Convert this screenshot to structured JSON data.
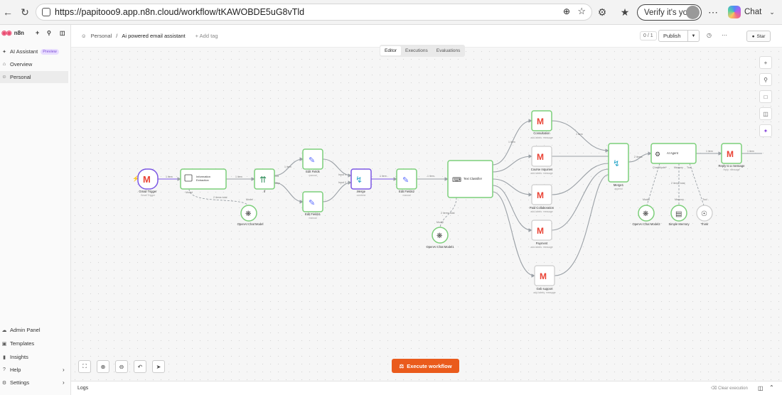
{
  "browser": {
    "url": "https://papitooo9.app.n8n.cloud/workflow/tKAWOBDE5uG8vTld",
    "verify_label": "Verify it's you",
    "chat_label": "Chat"
  },
  "sidebar": {
    "brand": "n8n",
    "items_top": [
      {
        "label": "AI Assistant",
        "badge": "Preview",
        "icon": "sparkle-icon"
      },
      {
        "label": "Overview",
        "icon": "home-icon"
      },
      {
        "label": "Personal",
        "icon": "user-icon"
      }
    ],
    "items_bottom": [
      {
        "label": "Admin Panel",
        "icon": "cloud-icon"
      },
      {
        "label": "Templates",
        "icon": "box-icon"
      },
      {
        "label": "Insights",
        "icon": "chart-icon"
      },
      {
        "label": "Help",
        "icon": "help-icon"
      },
      {
        "label": "Settings",
        "icon": "gear-icon"
      }
    ]
  },
  "header": {
    "project": "Personal",
    "workflow_title": "Ai powered email assistant",
    "add_tag": "+ Add tag",
    "version_count": "0 / 1",
    "publish_label": "Publish",
    "star_label": "Star"
  },
  "mode_tabs": [
    "Editor",
    "Executions",
    "Evaluations"
  ],
  "execute_label": "Execute workflow",
  "logs_label": "Logs",
  "clear_execution": "Clear execution",
  "workflow": {
    "nodes": [
      {
        "id": "gmail",
        "name": "Gmail Trigger",
        "sub": "Gmail Trigger",
        "icon": "gmail-icon"
      },
      {
        "id": "ie",
        "name": "Information Extraction",
        "icon": "extract-icon"
      },
      {
        "id": "if",
        "name": "If",
        "icon": "branch-icon"
      },
      {
        "id": "edit1",
        "name": "Edit Fields",
        "sub": "manual",
        "icon": "pencil-icon"
      },
      {
        "id": "edit2",
        "name": "Edit Fields1",
        "sub": "manual",
        "icon": "pencil-icon"
      },
      {
        "id": "merge",
        "name": "Merge",
        "sub": "combine",
        "icon": "merge-icon"
      },
      {
        "id": "edit3",
        "name": "Edit Fields2",
        "sub": "manual",
        "icon": "pencil-icon"
      },
      {
        "id": "tc",
        "name": "Text Classifier",
        "icon": "tag-icon"
      },
      {
        "id": "consult",
        "name": "Consultation",
        "sub": "add-labels: message",
        "icon": "gmail-icon"
      },
      {
        "id": "course",
        "name": "Course Inquiries",
        "sub": "add-labels: message",
        "icon": "gmail-icon"
      },
      {
        "id": "paid",
        "name": "Paid Collaboration",
        "sub": "add-labels: message",
        "icon": "gmail-icon"
      },
      {
        "id": "payment",
        "name": "Payment",
        "sub": "add-labels: message",
        "icon": "gmail-icon"
      },
      {
        "id": "geb",
        "name": "Geb support",
        "sub": "add-labels: message",
        "icon": "gmail-icon"
      },
      {
        "id": "merge1",
        "name": "Merge1",
        "sub": "append",
        "icon": "merge-icon"
      },
      {
        "id": "agent",
        "name": "AI Agent",
        "icon": "robot-icon"
      },
      {
        "id": "reply",
        "name": "Reply to a message",
        "sub": "reply: message",
        "icon": "gmail-icon"
      },
      {
        "id": "oai1",
        "name": "OpenAI Chat Model",
        "icon": "openai-icon"
      },
      {
        "id": "oai2",
        "name": "OpenAI Chat Model1",
        "icon": "openai-icon"
      },
      {
        "id": "oai3",
        "name": "OpenAI Chat Model2",
        "icon": "openai-icon"
      },
      {
        "id": "mem",
        "name": "Simple Memory",
        "icon": "memory-icon"
      },
      {
        "id": "think",
        "name": "Think",
        "icon": "think-icon"
      }
    ],
    "edge_labels": {
      "items1": "1 item",
      "items1b": "1 item",
      "items2": "2 items",
      "true_label": "true",
      "false_label": "false",
      "model": "Model",
      "memory": "Memory",
      "tool": "Tool",
      "chat_model": "Chat Model*",
      "input1": "Input 1",
      "input2": "Input 2",
      "items_total": "2 items total",
      "items_total2": "2 items total"
    }
  }
}
